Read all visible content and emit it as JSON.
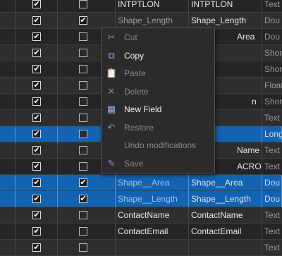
{
  "grid": {
    "rows": [
      {
        "visible": true,
        "readonly": false,
        "field": "INTPTLON",
        "alias": "INTPTLON",
        "type": "Text",
        "sel": false,
        "dimField": false
      },
      {
        "visible": true,
        "readonly": true,
        "field": "Shape_Length",
        "alias": "Shape_Length",
        "type": "Dou",
        "sel": false,
        "dimField": true
      },
      {
        "visible": true,
        "readonly": false,
        "field": "",
        "alias": "Area",
        "type": "Dou",
        "sel": false,
        "dimField": false
      },
      {
        "visible": true,
        "readonly": false,
        "field": "",
        "alias": "",
        "type": "Shor",
        "sel": false,
        "dimField": false
      },
      {
        "visible": true,
        "readonly": false,
        "field": "",
        "alias": "",
        "type": "Shor",
        "sel": false,
        "dimField": false
      },
      {
        "visible": true,
        "readonly": false,
        "field": "",
        "alias": "",
        "type": "Float",
        "sel": false,
        "dimField": false
      },
      {
        "visible": true,
        "readonly": false,
        "field": "",
        "alias": "n",
        "type": "Shor",
        "sel": false,
        "dimField": false
      },
      {
        "visible": true,
        "readonly": false,
        "field": "",
        "alias": "",
        "type": "Text",
        "sel": false,
        "dimField": false
      },
      {
        "visible": true,
        "readonly": false,
        "field": "",
        "alias": "",
        "type": "Long",
        "sel": true,
        "dimField": false
      },
      {
        "visible": true,
        "readonly": false,
        "field": "",
        "alias": "Name",
        "type": "Text",
        "sel": false,
        "dimField": false
      },
      {
        "visible": true,
        "readonly": false,
        "field": "",
        "alias": "ACRO",
        "type": "Text",
        "sel": false,
        "dimField": false
      },
      {
        "visible": true,
        "readonly": true,
        "field": "Shape__Area",
        "alias": "Shape__Area",
        "type": "Dou",
        "sel": true,
        "dimField": true
      },
      {
        "visible": true,
        "readonly": true,
        "field": "Shape__Length",
        "alias": "Shape__Length",
        "type": "Dou",
        "sel": true,
        "dimField": true
      },
      {
        "visible": true,
        "readonly": false,
        "field": "ContactName",
        "alias": "ContactName",
        "type": "Text",
        "sel": false,
        "dimField": false
      },
      {
        "visible": true,
        "readonly": false,
        "field": "ContactEmail",
        "alias": "ContactEmail",
        "type": "Text",
        "sel": false,
        "dimField": false
      },
      {
        "visible": true,
        "readonly": false,
        "field": "",
        "alias": "",
        "type": "Text",
        "sel": false,
        "dimField": false
      }
    ]
  },
  "context_menu": {
    "items": [
      {
        "label": "Cut",
        "icon": "scissors-icon",
        "glyph": "✂",
        "enabled": false,
        "color": "#8a8a8a"
      },
      {
        "label": "Copy",
        "icon": "copy-icon",
        "glyph": "⧉",
        "enabled": true,
        "color": "#7fb0e8"
      },
      {
        "label": "Paste",
        "icon": "paste-icon",
        "glyph": "📋",
        "enabled": false,
        "color": "#8a6a3a"
      },
      {
        "label": "Delete",
        "icon": "delete-x-icon",
        "glyph": "✕",
        "enabled": false,
        "color": "#8a8a8a"
      },
      {
        "label": "New Field",
        "icon": "new-field-icon",
        "glyph": "▦",
        "enabled": true,
        "color": "#8fb4e6"
      },
      {
        "label": "Restore",
        "icon": "restore-icon",
        "glyph": "↶",
        "enabled": false,
        "color": "#6b8fbf"
      },
      {
        "label": "Undo modifications",
        "icon": "",
        "glyph": "",
        "enabled": false,
        "color": "#8a8a8a"
      },
      {
        "label": "Save",
        "icon": "save-icon",
        "glyph": "✎",
        "enabled": false,
        "color": "#9a86c9"
      }
    ]
  }
}
